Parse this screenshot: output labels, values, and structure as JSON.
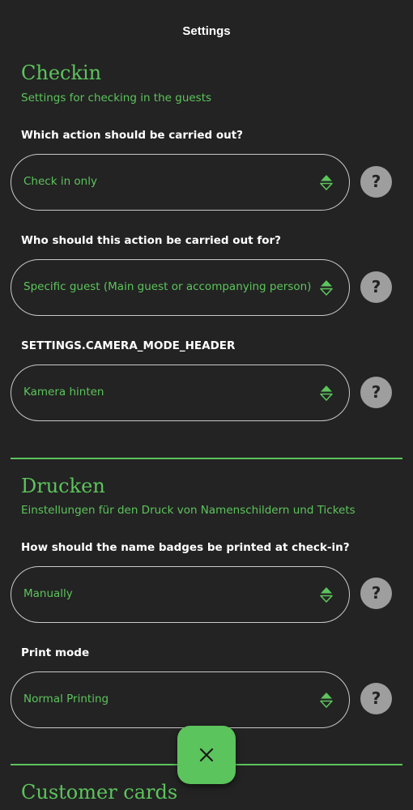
{
  "header": {
    "title": "Settings"
  },
  "sections": [
    {
      "title": "Checkin",
      "subtitle": "Settings for checking in the guests",
      "fields": [
        {
          "label": "Which action should be carried out?",
          "value": "Check in only",
          "help": "?"
        },
        {
          "label": "Who should this action be carried out for?",
          "value": "Specific guest (Main guest or accompanying person)",
          "help": "?"
        },
        {
          "label": "SETTINGS.CAMERA_MODE_HEADER",
          "value": "Kamera hinten",
          "help": "?"
        }
      ]
    },
    {
      "title": "Drucken",
      "subtitle": "Einstellungen für den Druck von Namenschildern und Tickets",
      "fields": [
        {
          "label": "How should the name badges be printed at check-in?",
          "value": "Manually",
          "help": "?"
        },
        {
          "label": "Print mode",
          "value": "Normal Printing",
          "help": "?"
        }
      ]
    },
    {
      "title": "Customer cards"
    }
  ],
  "fab": {
    "icon": "close-icon"
  },
  "colors": {
    "background": "#232323",
    "accent": "#5cc45c",
    "help_button": "#9e9e9e"
  }
}
